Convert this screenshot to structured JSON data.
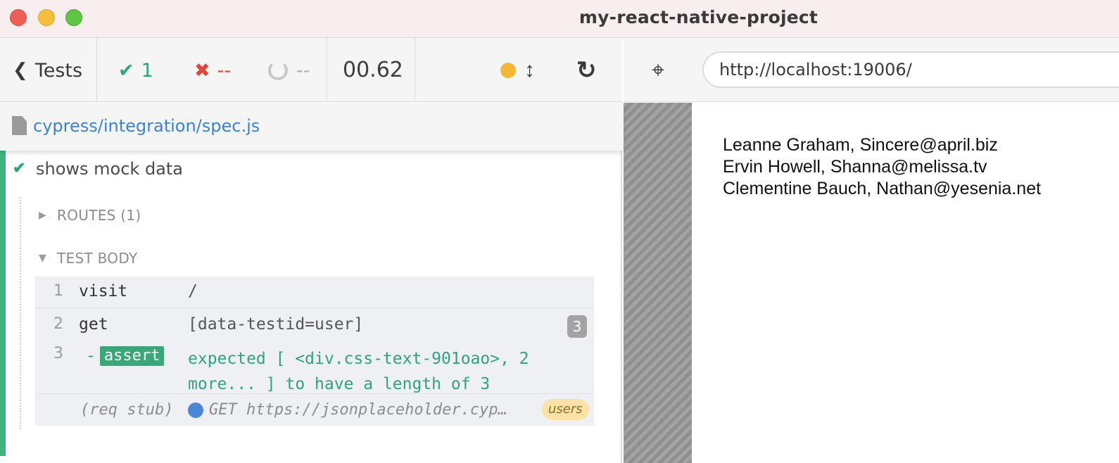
{
  "window": {
    "title": "my-react-native-project"
  },
  "toolbar": {
    "tests_label": "Tests",
    "passed_icon": "checkmark-icon",
    "passed_count": "1",
    "failed_icon": "x-icon",
    "failed_count": "--",
    "pending_icon": "spinner-icon",
    "pending_count": "--",
    "duration": "00.62",
    "status_dot_color": "#f5b735",
    "resize_icon": "vertical-resize-icon",
    "reload_icon": "reload-icon"
  },
  "spec": {
    "path": "cypress/integration/spec.js"
  },
  "test": {
    "title": "shows mock data",
    "status": "passed",
    "routes_label": "ROUTES (1)",
    "test_body_label": "TEST BODY",
    "commands": [
      {
        "num": "1",
        "name": "visit",
        "message": "/"
      },
      {
        "num": "2",
        "name": "get",
        "message": "[data-testid=user]",
        "count": "3"
      },
      {
        "num": "3",
        "name": "assert",
        "prefix": "-",
        "message_line1": "expected [ <div.css-text-901oao>, 2",
        "message_line2": "more... ] to have a length of 3"
      }
    ],
    "route_log": {
      "label": "(req stub)",
      "text": "GET https://jsonplaceholder.cyp…",
      "alias": "users",
      "dot_color": "#4a87d6"
    }
  },
  "aut": {
    "url": "http://localhost:19006/",
    "users": [
      "Leanne Graham, Sincere@april.biz",
      "Ervin Howell, Shanna@melissa.tv",
      "Clementine Bauch, Nathan@yesenia.net"
    ]
  },
  "colors": {
    "pass": "#2fa37b",
    "fail": "#e0453a",
    "link": "#3b82e0",
    "accent_bar": "#3eb57f"
  }
}
